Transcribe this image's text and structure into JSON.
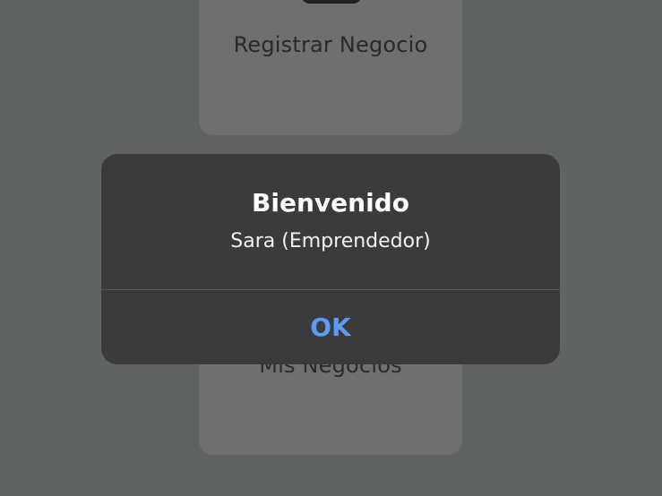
{
  "background": {
    "cards": [
      {
        "label": "Registrar Negocio",
        "icon": "briefcase-icon"
      },
      {
        "label": "Mis Negocios"
      }
    ]
  },
  "alert": {
    "title": "Bienvenido",
    "message": "Sara (Emprendedor)",
    "button_label": "OK"
  },
  "colors": {
    "overlay": "#5f6363",
    "alert_bg": "#3b3b3b",
    "button_text": "#5a9bf3"
  }
}
